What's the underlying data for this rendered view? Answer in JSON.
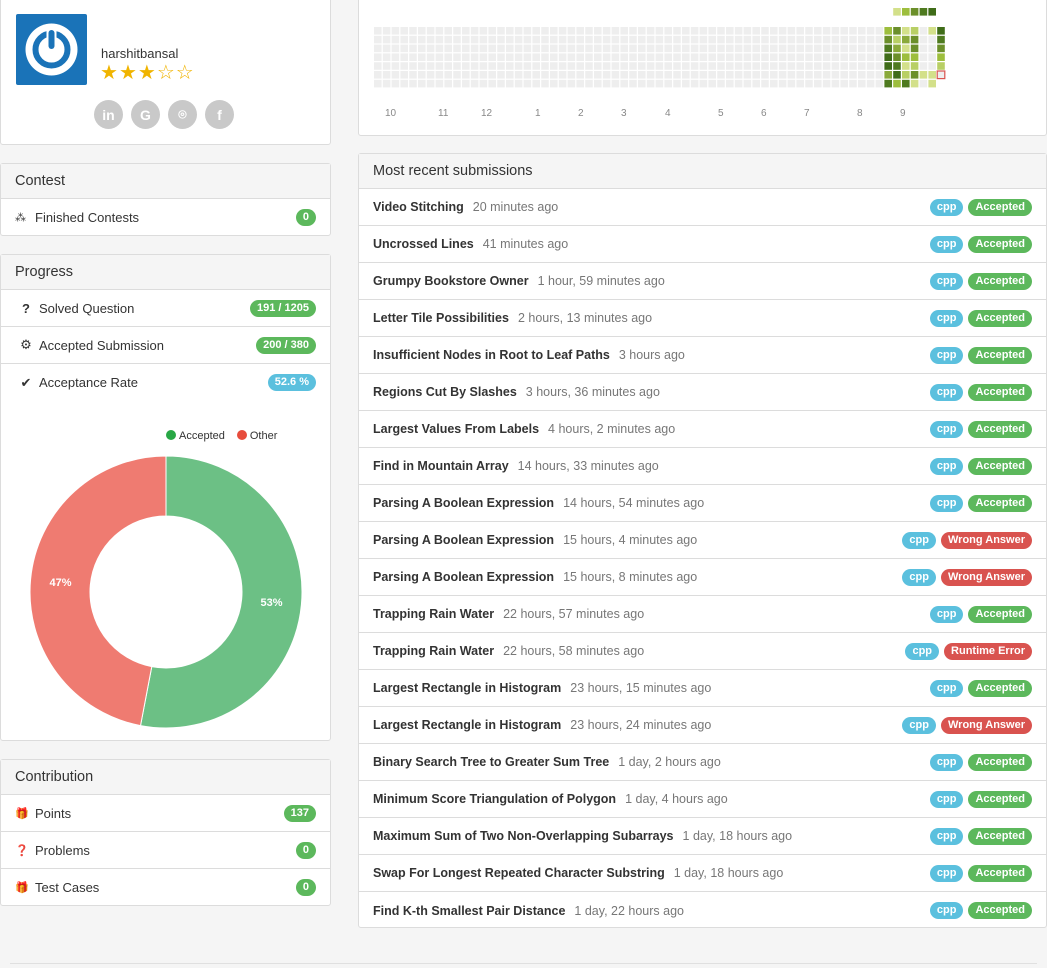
{
  "profile": {
    "username": "harshitbansal",
    "rating_stars": 3,
    "max_stars": 5,
    "social": [
      {
        "icon": "linkedin-icon",
        "glyph": "in"
      },
      {
        "icon": "google-icon",
        "glyph": "G"
      },
      {
        "icon": "github-icon",
        "glyph": "⌾"
      },
      {
        "icon": "facebook-icon",
        "glyph": "f"
      }
    ]
  },
  "contest": {
    "title": "Contest",
    "items": [
      {
        "icon": "contests-icon",
        "glyph": "⁂",
        "label": "Finished Contests",
        "value": "0",
        "color": "green"
      }
    ]
  },
  "progress": {
    "title": "Progress",
    "items": [
      {
        "icon": "question-icon",
        "glyph": "?",
        "label": "Solved Question",
        "value": "191 / 1205",
        "color": "green"
      },
      {
        "icon": "gear-icon",
        "glyph": "⚙",
        "label": "Accepted Submission",
        "value": "200 / 380",
        "color": "green"
      },
      {
        "icon": "checkmark-icon",
        "glyph": "✔",
        "label": "Acceptance Rate",
        "value": "52.6 %",
        "color": "blue"
      }
    ]
  },
  "chart_data": {
    "type": "pie",
    "categories": [
      "Accepted",
      "Other"
    ],
    "values": [
      53,
      47
    ],
    "labels": [
      "53%",
      "47%"
    ],
    "colors": [
      "#6cc085",
      "#ef7b71"
    ],
    "legend_dots": [
      "#28a745",
      "#e74c3c"
    ],
    "donut": true,
    "legend": "top"
  },
  "contribution": {
    "title": "Contribution",
    "items": [
      {
        "icon": "gift-icon",
        "glyph": "🎁",
        "label": "Points",
        "value": "137",
        "color": "green"
      },
      {
        "icon": "question-circle-icon",
        "glyph": "❓",
        "label": "Problems",
        "value": "0",
        "color": "green"
      },
      {
        "icon": "gift-icon",
        "glyph": "🎁",
        "label": "Test Cases",
        "value": "0",
        "color": "green"
      }
    ]
  },
  "heatmap": {
    "month_labels": [
      "10",
      "11",
      "12",
      "1",
      "2",
      "3",
      "4",
      "5",
      "6",
      "7",
      "8",
      "9"
    ]
  },
  "recent": {
    "title": "Most recent submissions",
    "items": [
      {
        "title": "Video Stitching",
        "time": "20 minutes ago",
        "lang": "cpp",
        "status": "Accepted",
        "color": "green"
      },
      {
        "title": "Uncrossed Lines",
        "time": "41 minutes ago",
        "lang": "cpp",
        "status": "Accepted",
        "color": "green"
      },
      {
        "title": "Grumpy Bookstore Owner",
        "time": "1 hour, 59 minutes ago",
        "lang": "cpp",
        "status": "Accepted",
        "color": "green"
      },
      {
        "title": "Letter Tile Possibilities",
        "time": "2 hours, 13 minutes ago",
        "lang": "cpp",
        "status": "Accepted",
        "color": "green"
      },
      {
        "title": "Insufficient Nodes in Root to Leaf Paths",
        "time": "3 hours ago",
        "lang": "cpp",
        "status": "Accepted",
        "color": "green"
      },
      {
        "title": "Regions Cut By Slashes",
        "time": "3 hours, 36 minutes ago",
        "lang": "cpp",
        "status": "Accepted",
        "color": "green"
      },
      {
        "title": "Largest Values From Labels",
        "time": "4 hours, 2 minutes ago",
        "lang": "cpp",
        "status": "Accepted",
        "color": "green"
      },
      {
        "title": "Find in Mountain Array",
        "time": "14 hours, 33 minutes ago",
        "lang": "cpp",
        "status": "Accepted",
        "color": "green"
      },
      {
        "title": "Parsing A Boolean Expression",
        "time": "14 hours, 54 minutes ago",
        "lang": "cpp",
        "status": "Accepted",
        "color": "green"
      },
      {
        "title": "Parsing A Boolean Expression",
        "time": "15 hours, 4 minutes ago",
        "lang": "cpp",
        "status": "Wrong Answer",
        "color": "red"
      },
      {
        "title": "Parsing A Boolean Expression",
        "time": "15 hours, 8 minutes ago",
        "lang": "cpp",
        "status": "Wrong Answer",
        "color": "red"
      },
      {
        "title": "Trapping Rain Water",
        "time": "22 hours, 57 minutes ago",
        "lang": "cpp",
        "status": "Accepted",
        "color": "green"
      },
      {
        "title": "Trapping Rain Water",
        "time": "22 hours, 58 minutes ago",
        "lang": "cpp",
        "status": "Runtime Error",
        "color": "red"
      },
      {
        "title": "Largest Rectangle in Histogram",
        "time": "23 hours, 15 minutes ago",
        "lang": "cpp",
        "status": "Accepted",
        "color": "green"
      },
      {
        "title": "Largest Rectangle in Histogram",
        "time": "23 hours, 24 minutes ago",
        "lang": "cpp",
        "status": "Wrong Answer",
        "color": "red"
      },
      {
        "title": "Binary Search Tree to Greater Sum Tree",
        "time": "1 day, 2 hours ago",
        "lang": "cpp",
        "status": "Accepted",
        "color": "green"
      },
      {
        "title": "Minimum Score Triangulation of Polygon",
        "time": "1 day, 4 hours ago",
        "lang": "cpp",
        "status": "Accepted",
        "color": "green"
      },
      {
        "title": "Maximum Sum of Two Non-Overlapping Subarrays",
        "time": "1 day, 18 hours ago",
        "lang": "cpp",
        "status": "Accepted",
        "color": "green"
      },
      {
        "title": "Swap For Longest Repeated Character Substring",
        "time": "1 day, 18 hours ago",
        "lang": "cpp",
        "status": "Accepted",
        "color": "green"
      },
      {
        "title": "Find K-th Smallest Pair Distance",
        "time": "1 day, 22 hours ago",
        "lang": "cpp",
        "status": "Accepted",
        "color": "green"
      }
    ]
  }
}
